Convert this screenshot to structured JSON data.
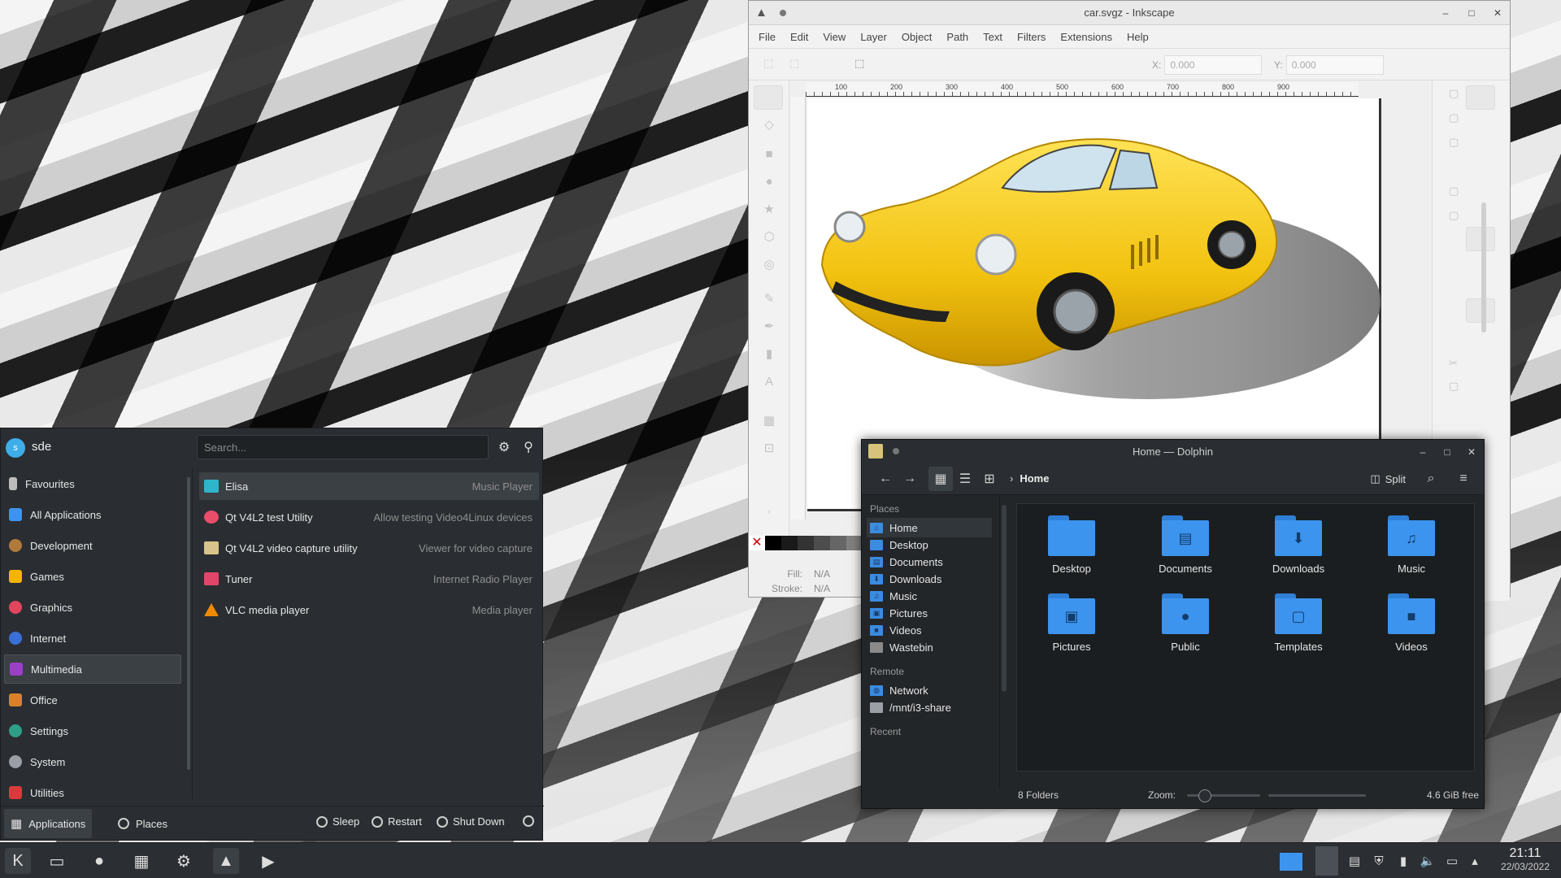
{
  "inkscape": {
    "title": "car.svgz - Inkscape",
    "menu": [
      "File",
      "Edit",
      "View",
      "Layer",
      "Object",
      "Path",
      "Text",
      "Filters",
      "Extensions",
      "Help"
    ],
    "x_label": "X:",
    "x_value": "0.000",
    "y_label": "Y:",
    "y_value": "0.000",
    "ruler_labels": [
      "100",
      "200",
      "300",
      "400",
      "500",
      "600",
      "700",
      "800",
      "900"
    ],
    "fill_label": "Fill:",
    "fill_value": "N/A",
    "stroke_label": "Stroke:",
    "stroke_value": "N/A",
    "car_color": "#F2C20F"
  },
  "dolphin": {
    "title": "Home — Dolphin",
    "breadcrumb": "Home",
    "split_label": "Split",
    "places_header": "Places",
    "places": [
      {
        "label": "Home",
        "icon": "home-icon"
      },
      {
        "label": "Desktop",
        "icon": "desktop-icon"
      },
      {
        "label": "Documents",
        "icon": "documents-icon"
      },
      {
        "label": "Downloads",
        "icon": "downloads-icon"
      },
      {
        "label": "Music",
        "icon": "music-icon"
      },
      {
        "label": "Pictures",
        "icon": "pictures-icon"
      },
      {
        "label": "Videos",
        "icon": "videos-icon"
      },
      {
        "label": "Wastebin",
        "icon": "trash-icon"
      }
    ],
    "remote_header": "Remote",
    "remote": [
      {
        "label": "Network",
        "icon": "network-icon"
      },
      {
        "label": "/mnt/i3-share",
        "icon": "share-icon"
      }
    ],
    "recent_header": "Recent",
    "folders": [
      {
        "label": "Desktop",
        "glyph": ""
      },
      {
        "label": "Documents",
        "glyph": "▤"
      },
      {
        "label": "Downloads",
        "glyph": "⬇"
      },
      {
        "label": "Music",
        "glyph": "♫"
      },
      {
        "label": "Pictures",
        "glyph": "▣"
      },
      {
        "label": "Public",
        "glyph": "●"
      },
      {
        "label": "Templates",
        "glyph": "▢"
      },
      {
        "label": "Videos",
        "glyph": "■"
      }
    ],
    "status_count": "8 Folders",
    "zoom_label": "Zoom:",
    "free_space": "4.6 GiB free"
  },
  "launcher": {
    "username": "sde",
    "avatar_letter": "s",
    "search_placeholder": "Search...",
    "categories": [
      {
        "label": "Favourites",
        "color": "#bdbdbd"
      },
      {
        "label": "All Applications",
        "color": "#3d94ee"
      },
      {
        "label": "Development",
        "color": "#b07a3a"
      },
      {
        "label": "Games",
        "color": "#f5b400"
      },
      {
        "label": "Graphics",
        "color": "#e2465c"
      },
      {
        "label": "Internet",
        "color": "#3a6fd8"
      },
      {
        "label": "Multimedia",
        "color": "#9b3fc7"
      },
      {
        "label": "Office",
        "color": "#d9822b"
      },
      {
        "label": "Settings",
        "color": "#2f9f86"
      },
      {
        "label": "System",
        "color": "#9a9fa5"
      },
      {
        "label": "Utilities",
        "color": "#d83b3b"
      }
    ],
    "apps": [
      {
        "name": "Elisa",
        "desc": "Music Player",
        "color": "#2fb5c9"
      },
      {
        "name": "Qt V4L2 test Utility",
        "desc": "Allow testing Video4Linux devices",
        "color": "#e84d6a"
      },
      {
        "name": "Qt V4L2 video capture utility",
        "desc": "Viewer for video capture",
        "color": "#d8c48a"
      },
      {
        "name": "Tuner",
        "desc": "Internet Radio Player",
        "color": "#e0466a"
      },
      {
        "name": "VLC media player",
        "desc": "Media player",
        "color": "#f08a00"
      }
    ],
    "tab_applications": "Applications",
    "tab_places": "Places",
    "sleep": "Sleep",
    "restart": "Restart",
    "shutdown": "Shut Down"
  },
  "taskbar": {
    "time": "21:11",
    "date": "22/03/2022"
  }
}
